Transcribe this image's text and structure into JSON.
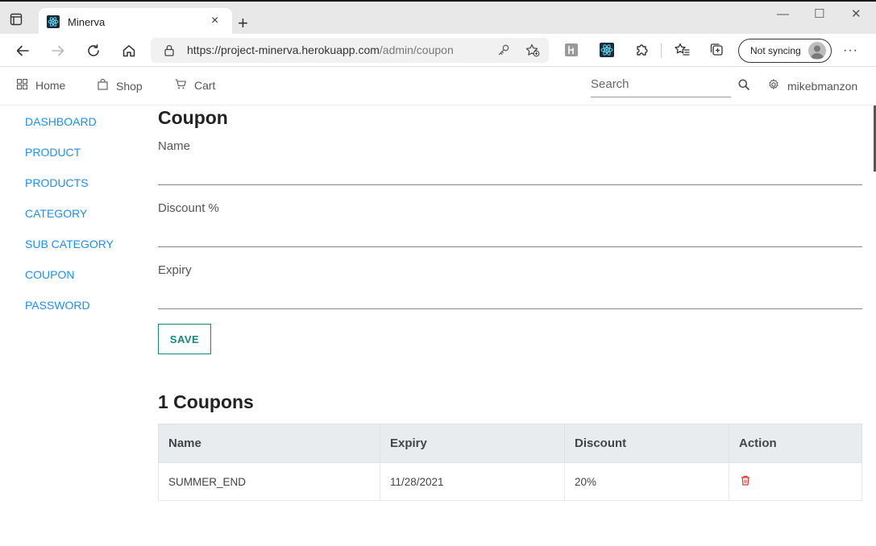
{
  "browser": {
    "tab_title": "Minerva",
    "tab_close": "×",
    "new_tab": "+",
    "win_min": "—",
    "win_max": "☐",
    "win_close": "✕",
    "url_host": "https://project-minerva.herokuapp.com",
    "url_path": "/admin/coupon",
    "sync_label": "Not syncing",
    "more": "···"
  },
  "nav": {
    "home": "Home",
    "shop": "Shop",
    "cart": "Cart",
    "search_placeholder": "Search",
    "user": "mikebmanzon"
  },
  "sidebar": {
    "items": [
      {
        "label": "DASHBOARD"
      },
      {
        "label": "PRODUCT"
      },
      {
        "label": "PRODUCTS"
      },
      {
        "label": "CATEGORY"
      },
      {
        "label": "SUB CATEGORY"
      },
      {
        "label": "COUPON"
      },
      {
        "label": "PASSWORD"
      }
    ]
  },
  "form": {
    "title": "Coupon",
    "name_label": "Name",
    "name_value": "",
    "discount_label": "Discount %",
    "discount_value": "",
    "expiry_label": "Expiry",
    "expiry_value": "",
    "save_label": "SAVE"
  },
  "table": {
    "count_title": "1 Coupons",
    "headers": [
      "Name",
      "Expiry",
      "Discount",
      "Action"
    ],
    "rows": [
      {
        "name": "SUMMER_END",
        "expiry": "11/28/2021",
        "discount": "20%"
      }
    ]
  },
  "colors": {
    "link": "#1890ff",
    "save": "#0f8a7e",
    "delete": "#e03131"
  }
}
